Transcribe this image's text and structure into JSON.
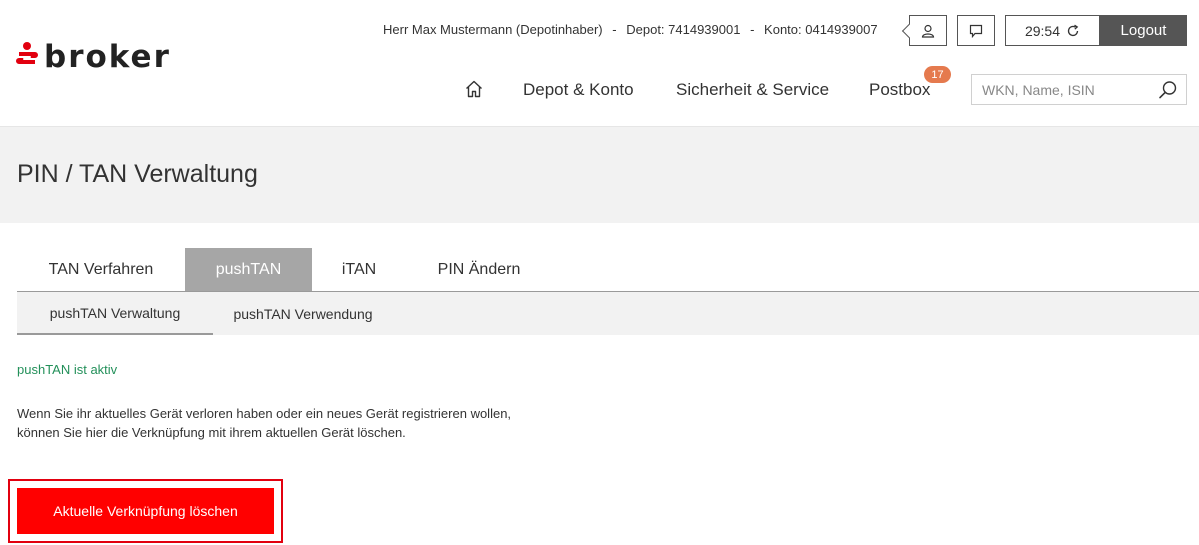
{
  "header": {
    "logo_text": "broker",
    "user_name": "Herr Max Mustermann (Depotinhaber)",
    "depot_label": "Depot: 7414939001",
    "konto_label": "Konto: 0414939007",
    "separator": "-",
    "session_timer": "29:54",
    "logout_label": "Logout"
  },
  "nav": {
    "items": [
      {
        "label": "Depot & Konto"
      },
      {
        "label": "Sicherheit & Service"
      },
      {
        "label": "Postbox",
        "badge": "17"
      }
    ]
  },
  "search": {
    "placeholder": "WKN, Name, ISIN",
    "value": ""
  },
  "page": {
    "title": "PIN / TAN Verwaltung"
  },
  "tabs": [
    {
      "label": "TAN Verfahren",
      "active": false
    },
    {
      "label": "pushTAN",
      "active": true
    },
    {
      "label": "iTAN",
      "active": false
    },
    {
      "label": "PIN Ändern",
      "active": false
    }
  ],
  "subtabs": [
    {
      "label": "pushTAN Verwaltung",
      "active": true
    },
    {
      "label": "pushTAN Verwendung",
      "active": false
    }
  ],
  "content": {
    "status_text": "pushTAN ist aktiv",
    "description_line1": "Wenn Sie ihr aktuelles Gerät verloren haben oder ein neues Gerät registrieren wollen,",
    "description_line2": "können Sie hier die Verknüpfung mit ihrem aktuellen Gerät löschen.",
    "delete_button_label": "Aktuelle Verknüpfung löschen"
  },
  "colors": {
    "brand_red": "#e2000f",
    "button_red": "#ff0000",
    "status_green": "#23905a",
    "badge_orange": "#e57a4e",
    "active_tab_gray": "#a6a6a6",
    "logout_gray": "#555555"
  }
}
